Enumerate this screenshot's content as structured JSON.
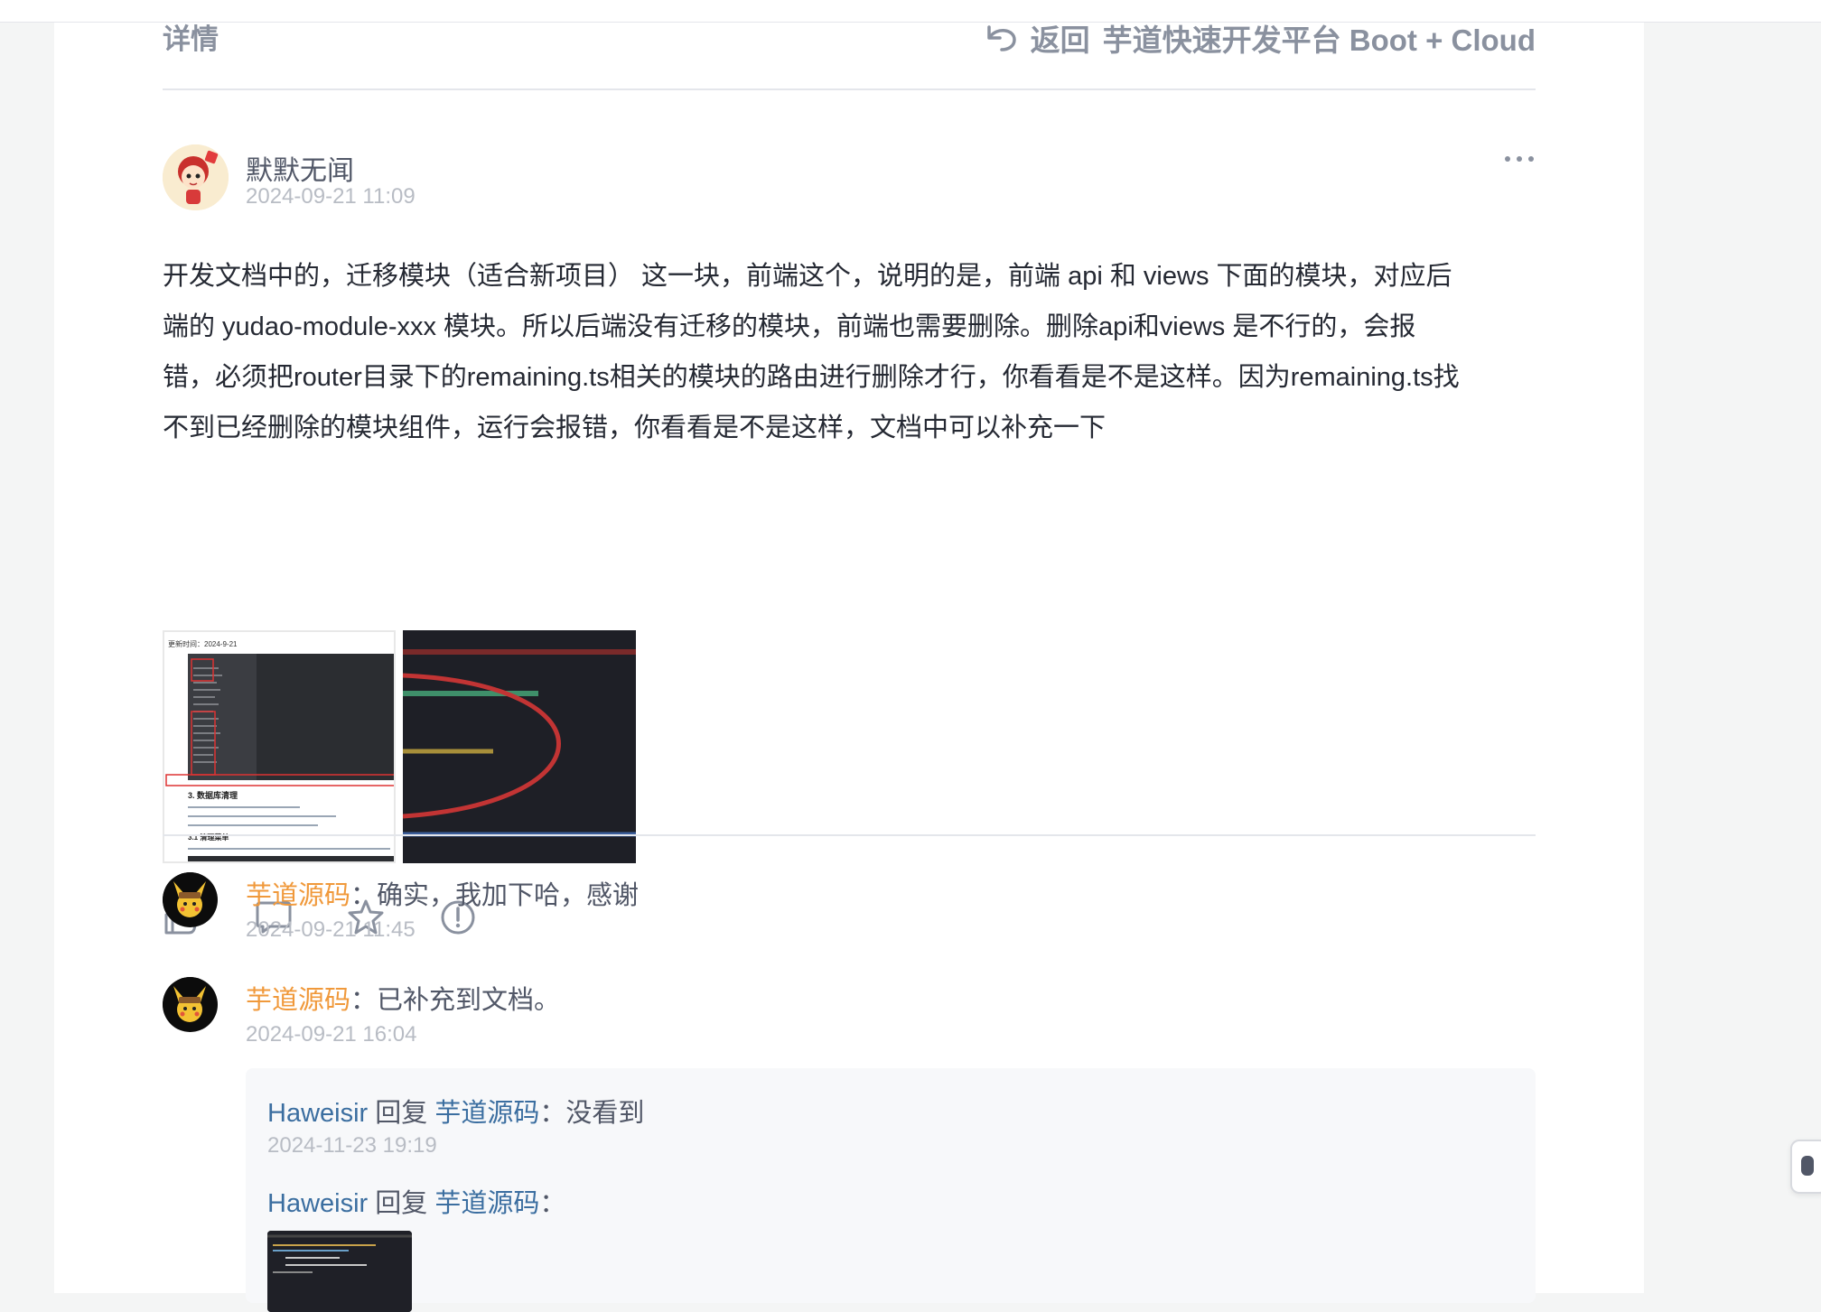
{
  "header": {
    "title": "详情",
    "back_label": "返回",
    "platform_title": "芋道快速开发平台 Boot + Cloud"
  },
  "post": {
    "author": "默默无闻",
    "time": "2024-09-21 11:09",
    "body_lines": [
      "开发文档中的，迁移模块（适合新项目）  这一块，前端这个，说明的是，前端 api 和 views 下面的模块，对应后",
      "端的 yudao-module-xxx 模块。所以后端没有迁移的模块，前端也需要删除。删除api和views 是不行的，会报",
      "错，必须把router目录下的remaining.ts相关的模块的路由进行删除才行，你看看是不是这样。因为remaining.ts找",
      "不到已经删除的模块组件，运行会报错，你看看是不是这样，文档中可以补充一下"
    ],
    "thumb1_caption": "更新时间：2024-9-21",
    "thumb1_section": "3. 数据库清理",
    "thumb1_section2": "3.1 清理菜单"
  },
  "actions": [
    "like-icon",
    "comment-icon",
    "star-icon",
    "report-icon"
  ],
  "comments": [
    {
      "author": "芋道源码",
      "text": "：确实，我加下哈，感谢",
      "time": "2024-09-21 11:45"
    },
    {
      "author": "芋道源码",
      "text": "：已补充到文档。",
      "time": "2024-09-21 16:04"
    }
  ],
  "replies": [
    {
      "author": "Haweisir",
      "reply_word": " 回复 ",
      "target": "芋道源码",
      "text": "：没看到",
      "time": "2024-11-23 19:19"
    },
    {
      "author": "Haweisir",
      "reply_word": " 回复 ",
      "target": "芋道源码",
      "text": "："
    }
  ],
  "colors": {
    "accent_orange": "#f0993b",
    "link_blue": "#3b6ea0",
    "muted": "#8a919f"
  }
}
